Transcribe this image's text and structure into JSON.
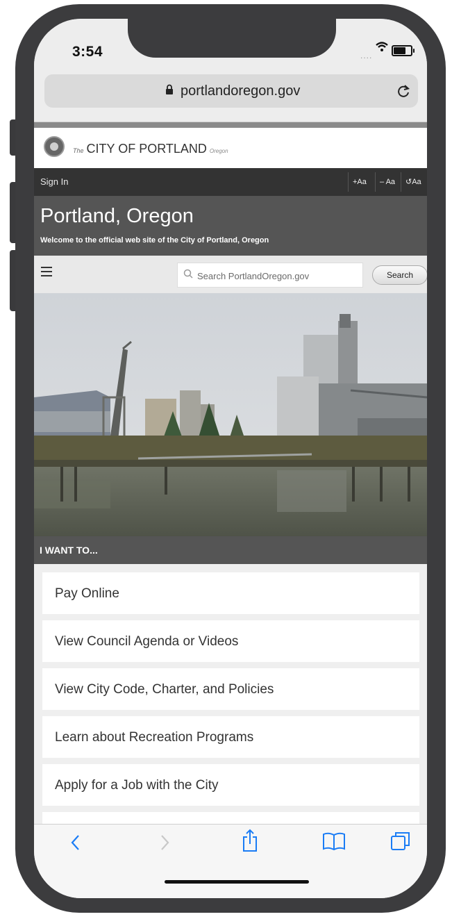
{
  "status_bar": {
    "time": "3:54",
    "signal_text": "....",
    "icons": [
      "wifi-icon",
      "battery-icon"
    ]
  },
  "browser": {
    "url": "portlandoregon.gov",
    "lock_icon": "lock-icon",
    "reload_icon": "reload-icon"
  },
  "site": {
    "logo": {
      "prefix": "The",
      "name": "CITY OF PORTLAND",
      "suffix": "Oregon"
    },
    "signin_label": "Sign In",
    "text_size_controls": [
      "+Aa",
      "– Aa",
      "↺Aa"
    ],
    "title": "Portland, Oregon",
    "welcome": "Welcome to the official web site of the City of Portland, Oregon",
    "search": {
      "placeholder": "Search PortlandOregon.gov",
      "button_label": "Search"
    },
    "i_want_to_heading": "I WANT TO...",
    "i_want_to_links": [
      "Pay Online",
      "View Council Agenda or Videos",
      "View City Code, Charter, and Policies",
      "Learn about Recreation Programs",
      "Apply for a Job with the City"
    ]
  },
  "toolbar": {
    "icons": [
      "back-icon",
      "forward-icon",
      "share-icon",
      "bookmarks-icon",
      "tabs-icon"
    ]
  },
  "colors": {
    "frame": "#3c3c3e",
    "site_dark": "#333333",
    "site_gray": "#555555",
    "ios_blue": "#1a7cf5"
  }
}
